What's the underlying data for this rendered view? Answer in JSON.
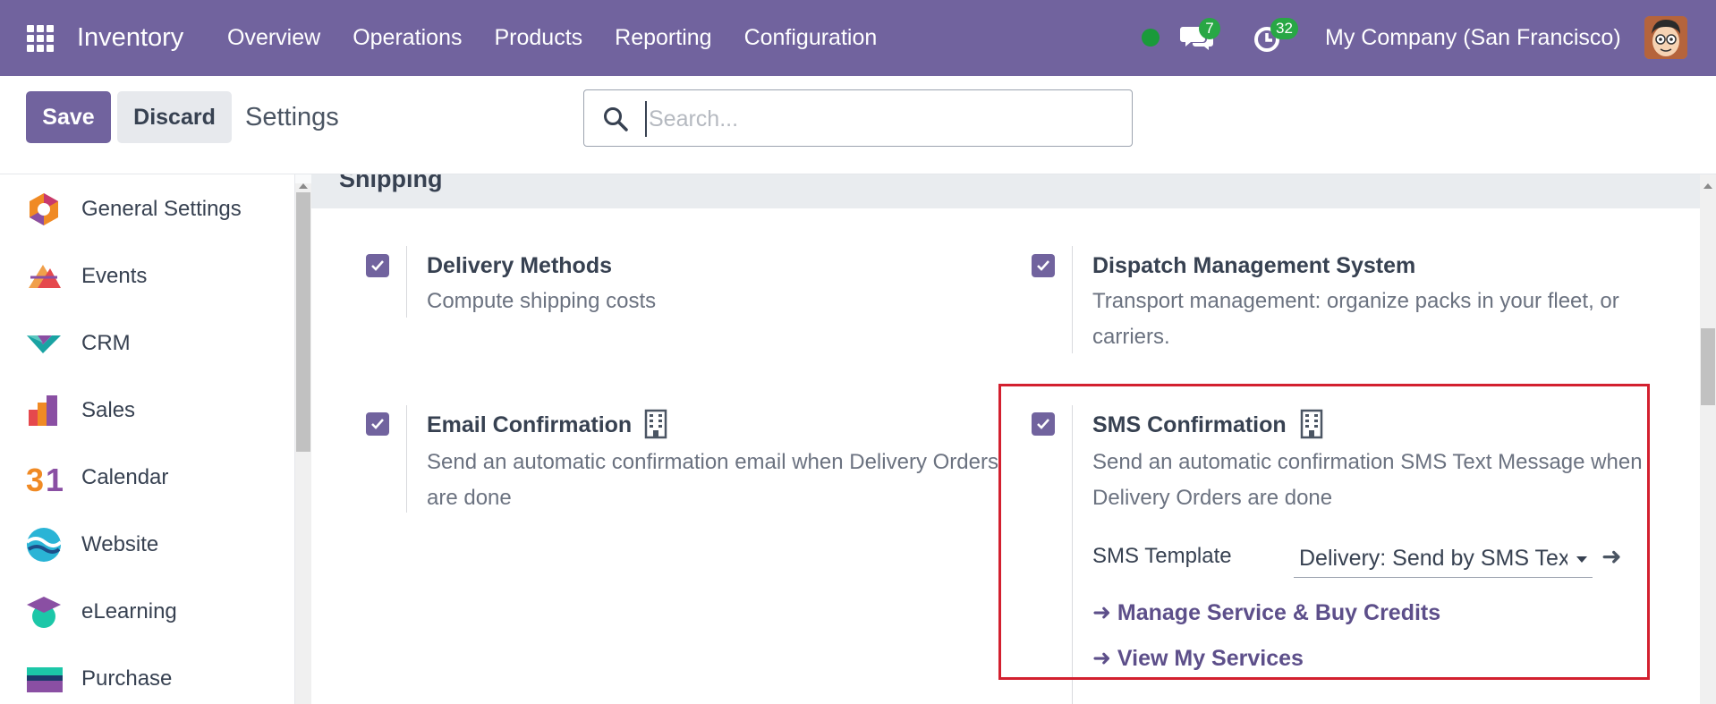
{
  "navbar": {
    "brand": "Inventory",
    "menu": [
      "Overview",
      "Operations",
      "Products",
      "Reporting",
      "Configuration"
    ],
    "messages_count": "7",
    "activities_count": "32",
    "company": "My Company (San Francisco)"
  },
  "control_panel": {
    "save_label": "Save",
    "discard_label": "Discard",
    "title": "Settings",
    "search_placeholder": "Search..."
  },
  "sidebar": {
    "items": [
      {
        "label": "General Settings",
        "icon": "general-settings-icon"
      },
      {
        "label": "Events",
        "icon": "events-icon"
      },
      {
        "label": "CRM",
        "icon": "crm-icon"
      },
      {
        "label": "Sales",
        "icon": "sales-icon"
      },
      {
        "label": "Calendar",
        "icon": "calendar-icon"
      },
      {
        "label": "Website",
        "icon": "website-icon"
      },
      {
        "label": "eLearning",
        "icon": "elearning-icon"
      },
      {
        "label": "Purchase",
        "icon": "purchase-icon"
      }
    ]
  },
  "section": {
    "title": "Shipping"
  },
  "settings": {
    "delivery_methods": {
      "title": "Delivery Methods",
      "desc": "Compute shipping costs",
      "checked": true
    },
    "dispatch": {
      "title": "Dispatch Management System",
      "desc": "Transport management: organize packs in your fleet, or carriers.",
      "checked": true
    },
    "email_confirmation": {
      "title": "Email Confirmation",
      "desc": "Send an automatic confirmation email when Delivery Orders are done",
      "checked": true
    },
    "sms_confirmation": {
      "title": "SMS Confirmation",
      "desc": "Send an automatic confirmation SMS Text Message when Delivery Orders are done",
      "checked": true,
      "template_label": "SMS Template",
      "template_value": "Delivery: Send by SMS Text Message",
      "link_manage": "Manage Service & Buy Credits",
      "link_view": "View My Services"
    }
  },
  "colors": {
    "brand": "#71639e",
    "badge": "#28a745",
    "highlight": "#d3202f"
  }
}
